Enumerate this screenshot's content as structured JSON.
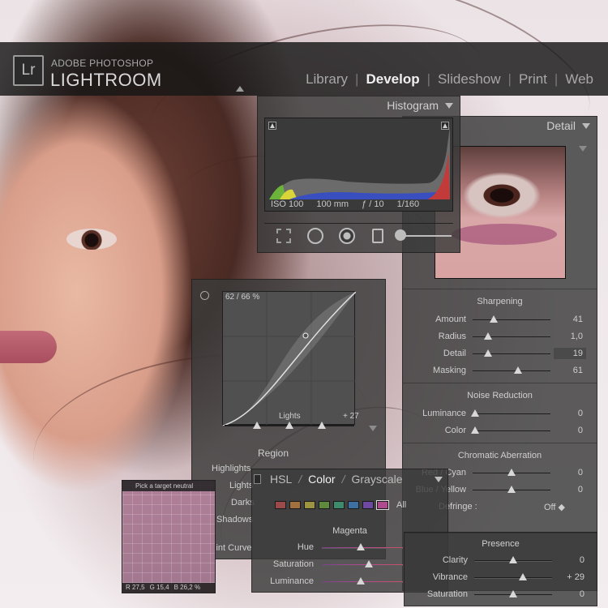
{
  "app": {
    "brand_small": "ADOBE PHOTOSHOP",
    "brand_big": "LIGHTROOM",
    "logo_text": "Lr",
    "modules": [
      {
        "label": "Library",
        "active": false
      },
      {
        "label": "Develop",
        "active": true
      },
      {
        "label": "Slideshow",
        "active": false
      },
      {
        "label": "Print",
        "active": false
      },
      {
        "label": "Web",
        "active": false
      }
    ],
    "module_separator": "|"
  },
  "histogram": {
    "title": "Histogram",
    "exif": {
      "iso": "ISO 100",
      "focal": "100 mm",
      "aperture": "ƒ / 10",
      "shutter": "1/160"
    },
    "tools": [
      "crop-overlay-icon",
      "spot-removal-icon",
      "red-eye-icon",
      "graduated-filter-icon",
      "adjustment-brush-icon"
    ]
  },
  "detail": {
    "title": "Detail",
    "sharpening": {
      "title": "Sharpening",
      "sliders": [
        {
          "label": "Amount",
          "value": "41",
          "pos": 0.27
        },
        {
          "label": "Radius",
          "value": "1,0",
          "pos": 0.2
        },
        {
          "label": "Detail",
          "value": "19",
          "pos": 0.2
        },
        {
          "label": "Masking",
          "value": "61",
          "pos": 0.58
        }
      ]
    },
    "noise_reduction": {
      "title": "Noise Reduction",
      "sliders": [
        {
          "label": "Luminance",
          "value": "0",
          "pos": 0.03
        },
        {
          "label": "Color",
          "value": "0",
          "pos": 0.03
        }
      ]
    },
    "chromatic_aberration": {
      "title": "Chromatic Aberration",
      "sliders": [
        {
          "label": "Red / Cyan",
          "value": "0",
          "pos": 0.5
        },
        {
          "label": "Blue / Yellow",
          "value": "0",
          "pos": 0.5
        }
      ],
      "defringe_label": "Defringe :",
      "defringe_value": "Off ◆"
    }
  },
  "tone_curve": {
    "readout": "62 / 66 %",
    "lights_label": "Lights",
    "lights_value": "+ 27",
    "region_title": "Region",
    "region_rows": [
      "Highlights",
      "Lights",
      "Darks",
      "Shadows"
    ],
    "point_curve_label": "Point Curve"
  },
  "hsl": {
    "tabs": [
      {
        "label": "HSL",
        "active": false
      },
      {
        "label": "Color",
        "active": true
      },
      {
        "label": "Grayscale",
        "active": false
      }
    ],
    "tab_separator": "/",
    "swatches": [
      "#9a4a4a",
      "#a0703e",
      "#9c9440",
      "#5f8a3e",
      "#3f8a6a",
      "#3e6fa0",
      "#6d4aa0",
      "#b04a8e"
    ],
    "all_label": "All",
    "section_title": "Magenta",
    "sliders": [
      {
        "label": "Hue",
        "pos": 0.48
      },
      {
        "label": "Saturation",
        "pos": 0.58
      },
      {
        "label": "Luminance",
        "pos": 0.48
      }
    ]
  },
  "target_neutral": {
    "title": "Pick a target neutral",
    "readout": [
      "R 27,5",
      "G 15,4",
      "B 26,2 %"
    ]
  },
  "presence": {
    "title": "Presence",
    "sliders": [
      {
        "label": "Clarity",
        "value": "0",
        "pos": 0.5
      },
      {
        "label": "Vibrance",
        "value": "+ 29",
        "pos": 0.62
      },
      {
        "label": "Saturation",
        "value": "0",
        "pos": 0.5
      }
    ]
  }
}
